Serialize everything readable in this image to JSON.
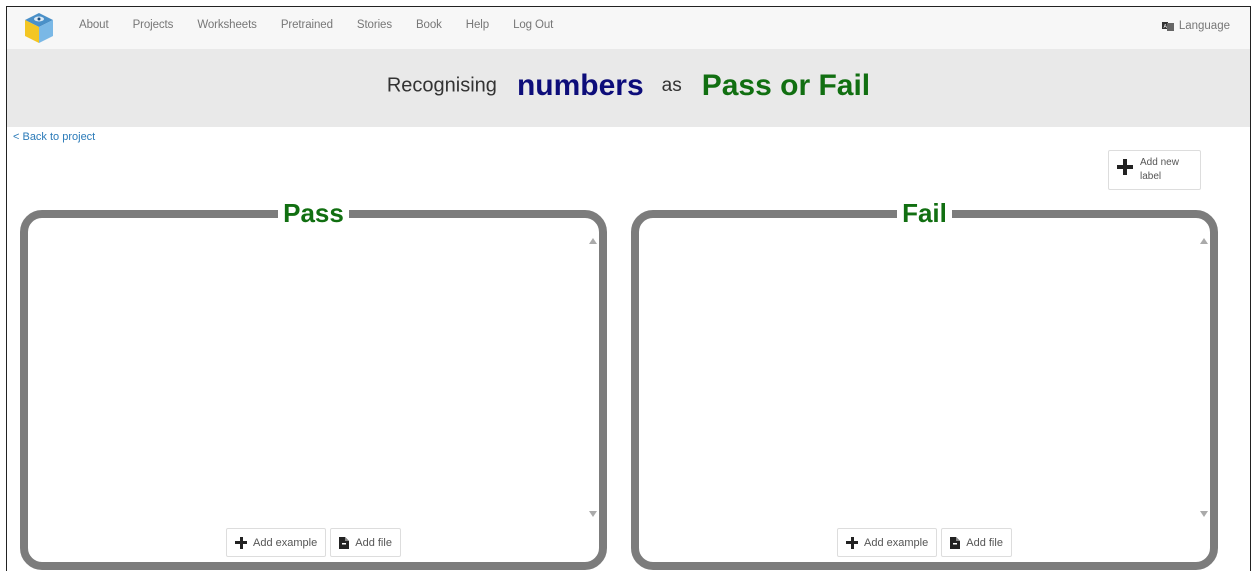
{
  "nav": {
    "logo": "cube-logo-icon",
    "items": [
      "About",
      "Projects",
      "Worksheets",
      "Pretrained",
      "Stories",
      "Book",
      "Help",
      "Log Out"
    ],
    "language": "Language",
    "language_icon": "language-icon"
  },
  "header": {
    "prefix": "Recognising",
    "type": "numbers",
    "as": "as",
    "labels": "Pass or Fail"
  },
  "back_link": "< Back to project",
  "add_label": "Add new label",
  "buckets": [
    {
      "title": "Pass",
      "add_example": "Add example",
      "add_file": "Add file"
    },
    {
      "title": "Fail",
      "add_example": "Add example",
      "add_file": "Add file"
    }
  ],
  "colors": {
    "type_accent": "#0d0d7a",
    "label_accent": "#116f11",
    "bucket_border": "#7c7c7c",
    "link": "#2a7ab8"
  }
}
